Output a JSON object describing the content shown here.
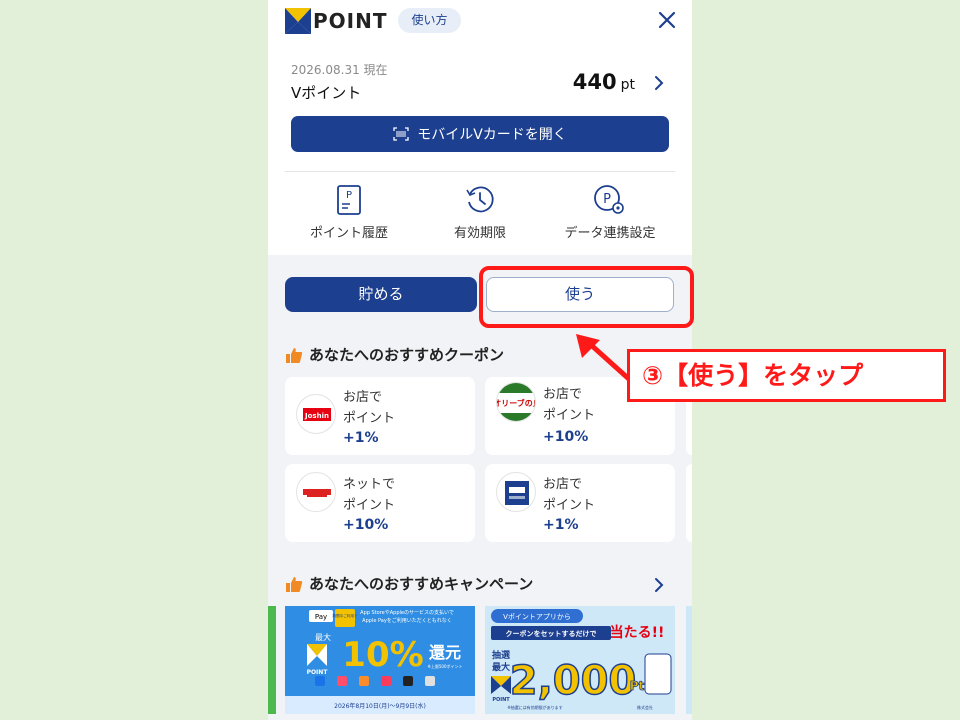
{
  "header": {
    "logo_text": "POINT",
    "howto_label": "使い方",
    "close_icon": "close-icon"
  },
  "balance": {
    "as_of": "2026.08.31 現在",
    "label": "Vポイント",
    "points": "440",
    "unit": "pt"
  },
  "open_card_button": "モバイルVカードを開く",
  "quick_actions": [
    {
      "label": "ポイント履歴",
      "icon": "point-history-icon"
    },
    {
      "label": "有効期限",
      "icon": "clock-icon"
    },
    {
      "label": "データ連携設定",
      "icon": "data-link-settings-icon"
    }
  ],
  "segments": {
    "earn": "貯める",
    "use": "使う",
    "selected": "earn"
  },
  "coupon_section": {
    "title": "あなたへのおすすめクーポン",
    "items": [
      {
        "line1": "お店で",
        "line2": "ポイント",
        "rate": "+1%",
        "logo": "Joshin"
      },
      {
        "line1": "お店で",
        "line2": "ポイント",
        "rate": "+10%",
        "logo": "オリーブの丘"
      },
      {
        "line1": "ネットで",
        "line2": "ポイント",
        "rate": "+10%",
        "logo": ""
      },
      {
        "line1": "お店で",
        "line2": "ポイント",
        "rate": "+1%",
        "logo": ""
      }
    ]
  },
  "campaign_section": {
    "title": "あなたへのおすすめキャンペーン",
    "banners": [
      {
        "badge": "Pay",
        "badge2": "期間中ご利用で",
        "text1": "App StoreやAppleのサービスの支払いで",
        "text2": "Apple Payをご利用いただくともれなく",
        "prefix": "最大",
        "big": "10%",
        "suffix": "還元",
        "note": "※上限500ポイント",
        "brand": "POINT",
        "period": "2026年8月10日(月)～9月9日(水)"
      },
      {
        "top": "Vポイントアプリから",
        "headline": "クーポンをセットするだけで",
        "headline2": "当たる!!",
        "left1": "抽選",
        "left2": "最大",
        "big": "2,000",
        "unit": "Pt",
        "brand": "POINT",
        "footnote": "※抽選には有効期限があります",
        "company": "株式会社"
      }
    ]
  },
  "annotation": {
    "callout": "③【使う】をタップ",
    "color": "#ff1a1a"
  },
  "colors": {
    "brand_blue": "#1d3f8f",
    "logo_yellow": "#f2c200",
    "background": "#e2f0d9"
  }
}
